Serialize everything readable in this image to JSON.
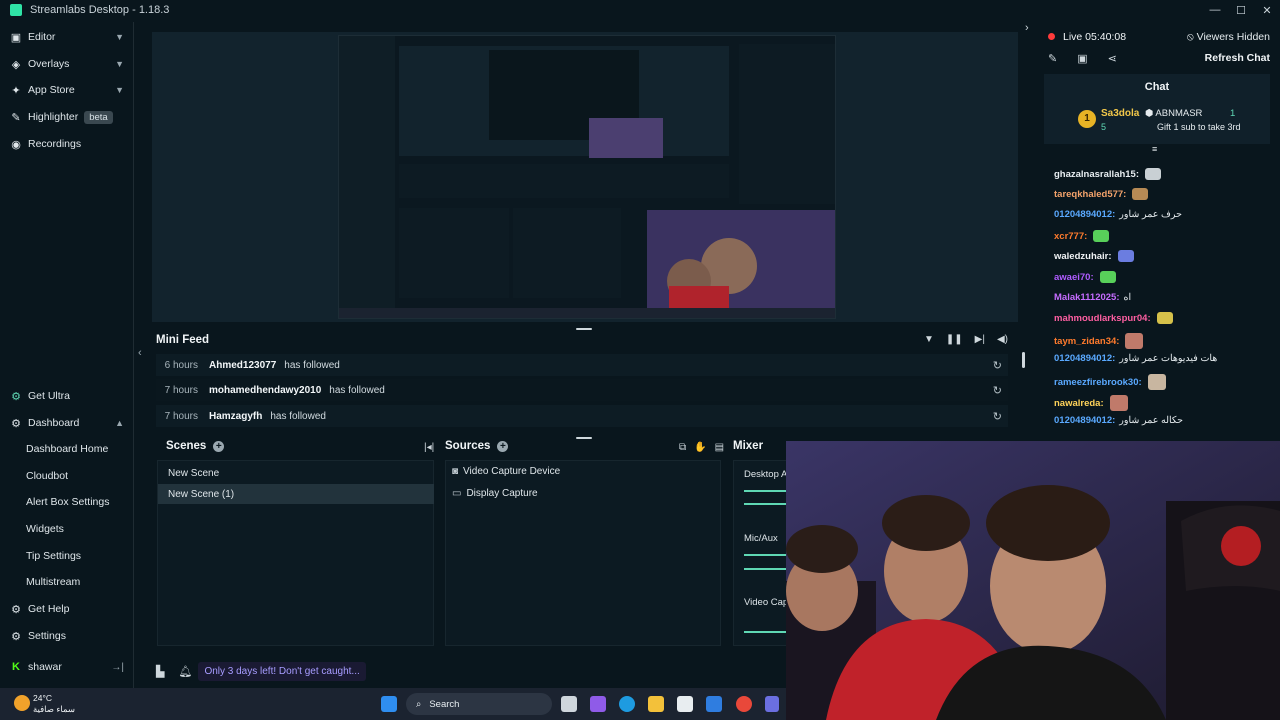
{
  "app": {
    "title": "Streamlabs Desktop - 1.18.3"
  },
  "sidebar": {
    "top": [
      {
        "label": "Editor",
        "icon": "editor-icon"
      },
      {
        "label": "Overlays",
        "icon": "overlays-icon"
      },
      {
        "label": "App Store",
        "icon": "app-store-icon"
      },
      {
        "label": "Highlighter",
        "icon": "highlighter-icon",
        "badge": "beta"
      },
      {
        "label": "Recordings",
        "icon": "recordings-icon"
      }
    ],
    "get_ultra": "Get Ultra",
    "dashboard": "Dashboard",
    "dashboard_items": [
      "Dashboard Home",
      "Cloudbot",
      "Alert Box Settings",
      "Widgets",
      "Tip Settings",
      "Multistream"
    ],
    "get_help": "Get Help",
    "settings": "Settings",
    "user": "shawar"
  },
  "minifeed": {
    "title": "Mini Feed",
    "rows": [
      {
        "time": "6 hours",
        "user": "Ahmed123077",
        "action": "has followed"
      },
      {
        "time": "7 hours",
        "user": "mohamedhendawy2010",
        "action": "has followed"
      },
      {
        "time": "7 hours",
        "user": "Hamzagyfh",
        "action": "has followed"
      }
    ]
  },
  "scenes": {
    "title": "Scenes",
    "items": [
      "New Scene",
      "New Scene (1)"
    ],
    "active": 1
  },
  "sources": {
    "title": "Sources",
    "items": [
      {
        "label": "Video Capture Device",
        "icon": "camera-icon"
      },
      {
        "label": "Display Capture",
        "icon": "monitor-icon"
      }
    ]
  },
  "mixer": {
    "title": "Mixer",
    "items": [
      "Desktop A",
      "Mic/Aux",
      "Video Cap"
    ]
  },
  "promo": "Only 3 days left! Don't get caught...",
  "chat": {
    "live": "Live 05:40:08",
    "viewers": "Viewers Hidden",
    "refresh": "Refresh Chat",
    "header": "Chat",
    "leader": {
      "rank": "1",
      "name": "Sa3dola",
      "count": "5",
      "top_user": "ABNMASR",
      "top_count": "1",
      "gift_text": "Gift 1 sub to take 3rd"
    },
    "messages": [
      {
        "user": "ghazalnasrallah15:",
        "text": "",
        "color": "#f0f3f5",
        "emote": "#c9d0d4"
      },
      {
        "user": "tareqkhaled577:",
        "text": "",
        "color": "#f4a36b",
        "emote": "#b68a55"
      },
      {
        "user": "01204894012:",
        "text": "حرف عمر شاور",
        "color": "#5aa9ff",
        "emote": ""
      },
      {
        "user": "xcr777:",
        "text": "",
        "color": "#ff7b2d",
        "emote": "#58d05a"
      },
      {
        "user": "waledzuhair:",
        "text": "",
        "color": "#f0f3f5",
        "emote": "#6b7de0"
      },
      {
        "user": "awaei70:",
        "text": "",
        "color": "#b05cff",
        "emote": "#58d05a"
      },
      {
        "user": "Malak1112025:",
        "text": "اه",
        "color": "#c56cff",
        "emote": ""
      },
      {
        "user": "mahmoudlarkspur04:",
        "text": "",
        "color": "#ff5fa2",
        "emote": "#d6c14a"
      },
      {
        "user": "taym_zidan34:",
        "text": "",
        "color": "#ff7b2d",
        "emote": "#c07a6a"
      },
      {
        "user": "01204894012:",
        "text": "هات فيديوهات عمر شاور",
        "color": "#5aa9ff",
        "emote": ""
      },
      {
        "user": "rameezfirebrook30:",
        "text": "",
        "color": "#5aa9ff",
        "emote": "#c8b6a0"
      },
      {
        "user": "nawalreda:",
        "text": "",
        "color": "#ffd35a",
        "emote": "#c07a6a"
      },
      {
        "user": "01204894012:",
        "text": "حكاله عمر شاور",
        "color": "#5aa9ff",
        "emote": ""
      }
    ]
  },
  "taskbar": {
    "temp": "24°C",
    "weather": "سماء صافية",
    "search": "Search"
  }
}
